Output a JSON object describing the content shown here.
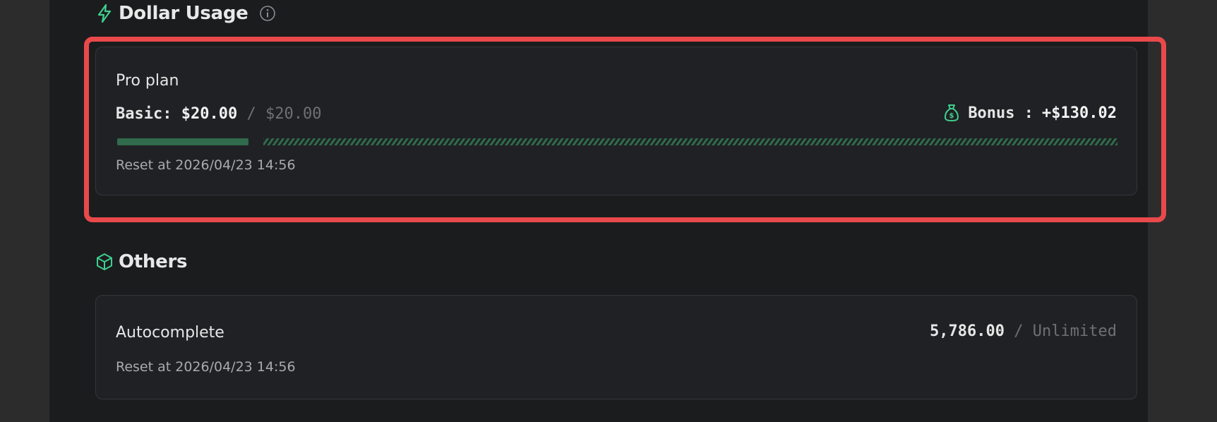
{
  "dollar_usage": {
    "title": "Dollar Usage",
    "card": {
      "plan_name": "Pro plan",
      "basic_label": "Basic:",
      "basic_used": "$20.00",
      "separator": "/",
      "basic_limit": "$20.00",
      "bonus_label": "Bonus :",
      "bonus_value": "+$130.02",
      "progress_fraction": 1.0,
      "reset_text": "Reset at 2026/04/23 14:56"
    }
  },
  "others": {
    "title": "Others",
    "card": {
      "name": "Autocomplete",
      "used": "5,786.00",
      "separator": "/",
      "limit": "Unlimited",
      "reset_text": "Reset at 2026/04/23 14:56"
    }
  },
  "colors": {
    "accent_green": "#3fcf8e",
    "bar_green": "#2f6b4c",
    "highlight_red": "#e9494a"
  },
  "icons": {
    "dollar_usage": "lightning-bolt-icon",
    "info": "info-circle-icon",
    "bonus": "money-bag-icon",
    "others": "cube-icon"
  }
}
